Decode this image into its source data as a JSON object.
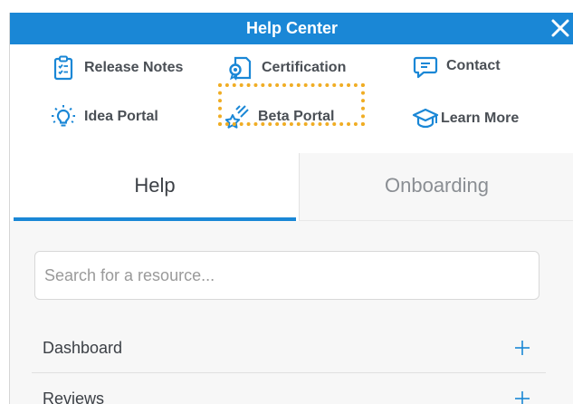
{
  "header": {
    "title": "Help Center",
    "close_icon": "close-icon"
  },
  "quick_links": [
    {
      "label": "Release Notes",
      "icon": "clipboard-icon"
    },
    {
      "label": "Certification",
      "icon": "certificate-icon"
    },
    {
      "label": "Contact",
      "icon": "chat-icon"
    },
    {
      "label": "Idea Portal",
      "icon": "lightbulb-icon"
    },
    {
      "label": "Beta Portal",
      "icon": "shooting-star-icon"
    },
    {
      "label": "Learn More",
      "icon": "graduation-cap-icon"
    }
  ],
  "tabs": [
    {
      "label": "Help",
      "active": true
    },
    {
      "label": "Onboarding",
      "active": false
    }
  ],
  "search": {
    "placeholder": "Search for a resource..."
  },
  "sections": [
    {
      "label": "Dashboard",
      "icon": "plus-icon"
    },
    {
      "label": "Reviews",
      "icon": "plus-icon"
    }
  ],
  "colors": {
    "accent": "#1a87d6",
    "icon": "#1a87d6",
    "highlight_border": "#f0ad24",
    "text": "#4a4f55"
  }
}
